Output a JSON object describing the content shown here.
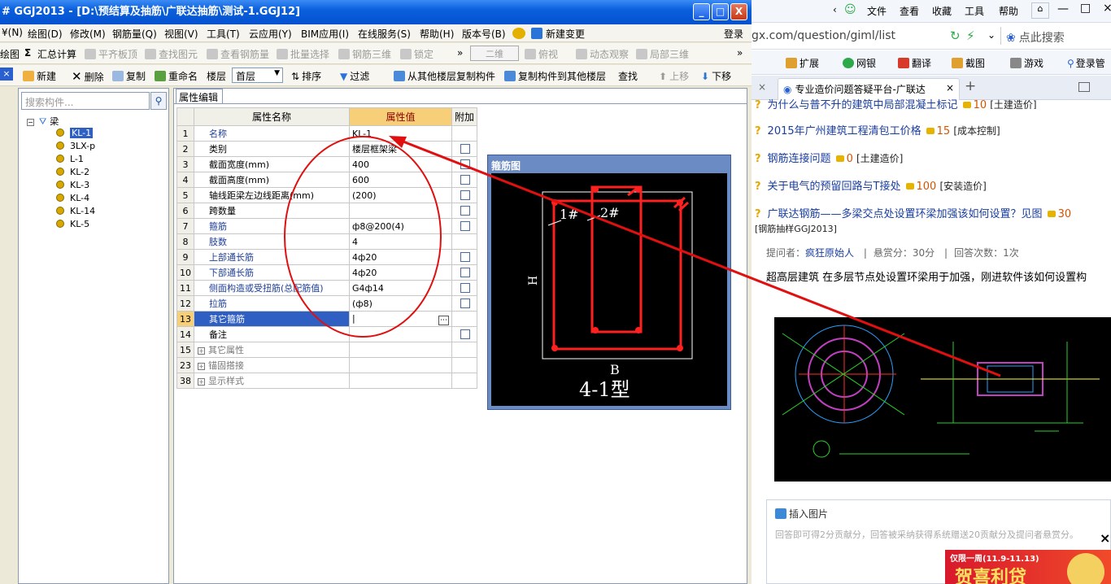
{
  "window": {
    "title": "# GGJ2013 - [D:\\预结算及抽筋\\广联达抽筋\\测试-1.GGJ12]",
    "min": "_",
    "max": "□",
    "close": "X"
  },
  "menu": [
    "¥(N)",
    "绘图(D)",
    "修改(M)",
    "钢筋量(Q)",
    "视图(V)",
    "工具(T)",
    "云应用(Y)",
    "BIM应用(I)",
    "在线服务(S)",
    "帮助(H)",
    "版本号(B)",
    "新建变更"
  ],
  "login": "登录",
  "toolbar1": {
    "draw": "绘图",
    "sum": "汇总计算",
    "items": [
      "平齐板顶",
      "查找图元",
      "查看钢筋量",
      "批量选择",
      "钢筋三维",
      "锁定"
    ],
    "view_select": "二维",
    "items2": [
      "俯视",
      "动态观察",
      "局部三维"
    ],
    "more": "»"
  },
  "toolbar2": {
    "new": "新建",
    "delete": "删除",
    "copy": "复制",
    "rename": "重命名",
    "floor_label": "楼层",
    "floor_value": "首层",
    "sort": "排序",
    "filter": "过滤",
    "copy_from": "从其他楼层复制构件",
    "copy_to": "复制构件到其他楼层",
    "find": "查找",
    "up": "上移",
    "down": "下移"
  },
  "tree": {
    "search_placeholder": "搜索构件...",
    "root": "梁",
    "items": [
      "KL-1",
      "3LX-p",
      "L-1",
      "KL-2",
      "KL-3",
      "KL-4",
      "KL-14",
      "KL-5"
    ]
  },
  "panel": {
    "tab": "属性编辑",
    "headers": [
      "属性名称",
      "属性值",
      "附加"
    ],
    "rows": [
      {
        "no": "1",
        "name": "名称",
        "value": "KL-1",
        "cb": false,
        "blue": true
      },
      {
        "no": "2",
        "name": "类别",
        "value": "楼层框架梁",
        "cb": true,
        "blue": false
      },
      {
        "no": "3",
        "name": "截面宽度(mm)",
        "value": "400",
        "cb": true,
        "blue": false
      },
      {
        "no": "4",
        "name": "截面高度(mm)",
        "value": "600",
        "cb": true,
        "blue": false
      },
      {
        "no": "5",
        "name": "轴线距梁左边线距离(mm)",
        "value": "(200)",
        "cb": true,
        "blue": false
      },
      {
        "no": "6",
        "name": "跨数量",
        "value": "",
        "cb": true,
        "blue": false
      },
      {
        "no": "7",
        "name": "箍筋",
        "value": "ф8@200(4)",
        "cb": true,
        "blue": true
      },
      {
        "no": "8",
        "name": "肢数",
        "value": "4",
        "cb": false,
        "blue": true
      },
      {
        "no": "9",
        "name": "上部通长筋",
        "value": "4ф20",
        "cb": true,
        "blue": true
      },
      {
        "no": "10",
        "name": "下部通长筋",
        "value": "4ф20",
        "cb": true,
        "blue": true
      },
      {
        "no": "11",
        "name": "侧面构造或受扭筋(总配筋值)",
        "value": "G4ф14",
        "cb": true,
        "blue": true
      },
      {
        "no": "12",
        "name": "拉筋",
        "value": "(ф8)",
        "cb": true,
        "blue": true
      },
      {
        "no": "13",
        "name": "其它箍筋",
        "value": "|",
        "cb": false,
        "blue": false,
        "selected": true
      },
      {
        "no": "14",
        "name": "备注",
        "value": "",
        "cb": true,
        "blue": false
      },
      {
        "no": "15",
        "name": "其它属性",
        "value": "",
        "cb": false,
        "group": true
      },
      {
        "no": "23",
        "name": "锚固搭接",
        "value": "",
        "cb": false,
        "group": true
      },
      {
        "no": "38",
        "name": "显示样式",
        "value": "",
        "cb": false,
        "group": true
      }
    ]
  },
  "stirrup": {
    "title": "箍筋图",
    "label1": "1#",
    "label2": "2#",
    "h": "H",
    "b": "B",
    "type": "4-1型"
  },
  "browser": {
    "menu": [
      "文件",
      "查看",
      "收藏",
      "工具",
      "帮助"
    ],
    "url": "gx.com/question/giml/list",
    "search_placeholder": "点此搜索",
    "toolbar": [
      "扩展",
      "网银",
      "翻译",
      "截图",
      "游戏",
      "登录管"
    ],
    "tab": "专业造价问题答疑平台-广联达",
    "tab_close": "×",
    "new_tab": "+",
    "q0": {
      "text": "为什么与普不升的建筑中局部混凝土标记",
      "pts": "10",
      "cat": "[土建造价]"
    },
    "q1": {
      "text": "2015年广州建筑工程清包工价格",
      "pts": "15",
      "cat": "[成本控制]"
    },
    "q2": {
      "text": "钢筋连接问题",
      "pts": "0",
      "cat": "[土建造价]"
    },
    "q3": {
      "text": "关于电气的预留回路与T接处",
      "pts": "100",
      "cat": "[安装造价]"
    },
    "q4": {
      "text": "广联达钢筋——多梁交点处设置环梁加强该如何设置？见图",
      "pts": "30",
      "cat": "[钢筋抽样GGJ2013]"
    },
    "meta": {
      "asker_label": "提问者：",
      "asker": "疯狂原始人",
      "reward": "悬赏分：30分",
      "replies": "回答次数：1次"
    },
    "desc": "超高层建筑  在多层节点处设置环梁用于加强，刚进软件该如何设置构",
    "insert_image": "插入图片",
    "reply_placeholder": "回答即可得2分贡献分，回答被采纳获得系统赠送20贡献分及提问者悬赏分。",
    "ad_tag": "仅限一周(11.9-11.13)",
    "ad_text": "贺喜利贷",
    "ad_close": "×"
  },
  "colors": {
    "titlebar": "#0552d0",
    "accent": "#2f5fc2",
    "annotation": "#e01010",
    "rebar": "#ff2020"
  }
}
